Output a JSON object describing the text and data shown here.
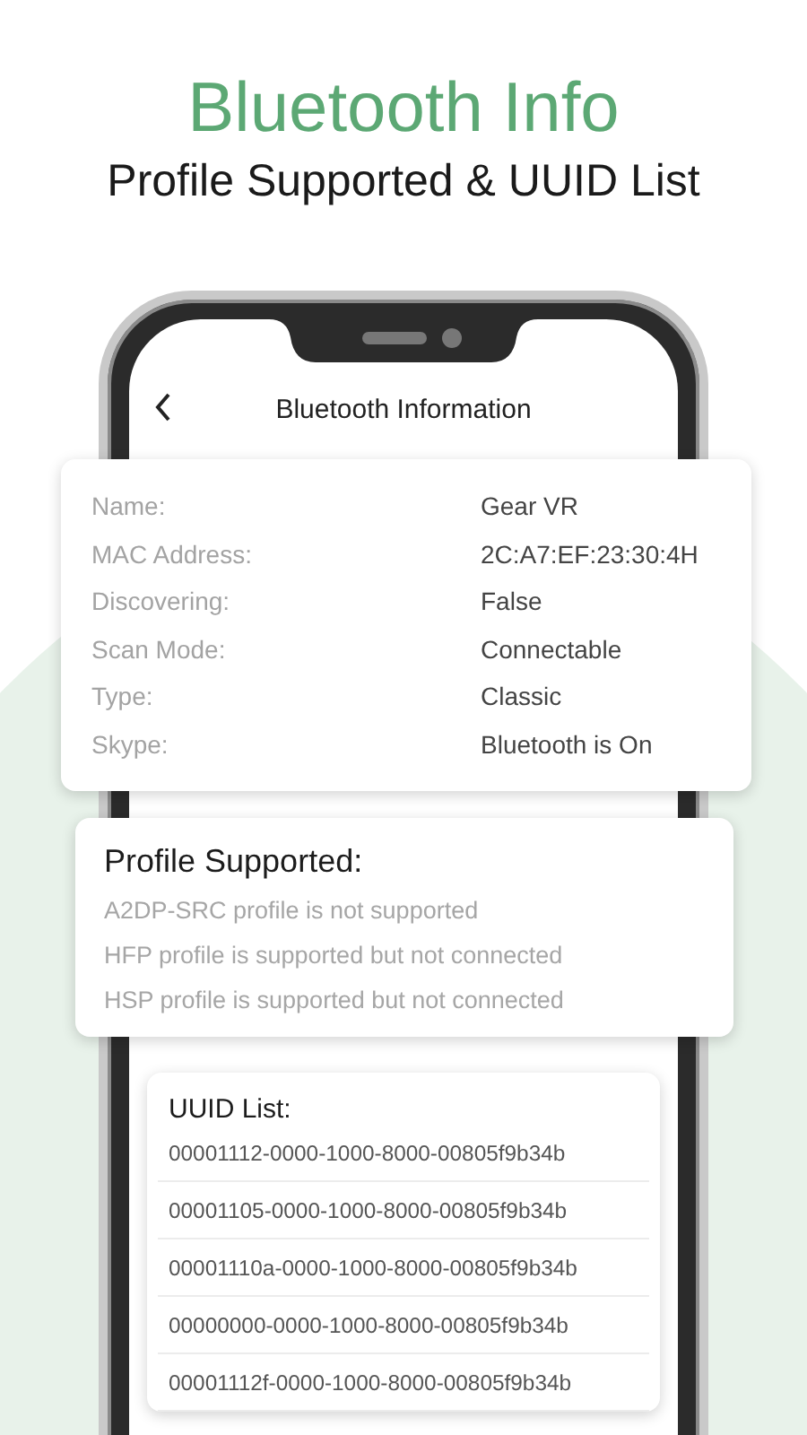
{
  "header": {
    "title": "Bluetooth Info",
    "subtitle": "Profile Supported & UUID List"
  },
  "screen": {
    "title": "Bluetooth Information"
  },
  "details": [
    {
      "label": "Name:",
      "value": "Gear VR"
    },
    {
      "label": "MAC Address:",
      "value": "2C:A7:EF:23:30:4H"
    },
    {
      "label": "Discovering:",
      "value": "False"
    },
    {
      "label": "Scan Mode:",
      "value": "Connectable"
    },
    {
      "label": "Type:",
      "value": "Classic"
    },
    {
      "label": "Skype:",
      "value": "Bluetooth is On"
    }
  ],
  "profiles": {
    "title": "Profile Supported:",
    "items": [
      "A2DP-SRC profile is not supported",
      "HFP profile is supported but not connected",
      "HSP profile is supported but not connected"
    ]
  },
  "uuids": {
    "title": "UUID List:",
    "items": [
      "00001112-0000-1000-8000-00805f9b34b",
      "00001105-0000-1000-8000-00805f9b34b",
      "00001110a-0000-1000-8000-00805f9b34b",
      "00000000-0000-1000-8000-00805f9b34b",
      "00001112f-0000-1000-8000-00805f9b34b"
    ]
  }
}
